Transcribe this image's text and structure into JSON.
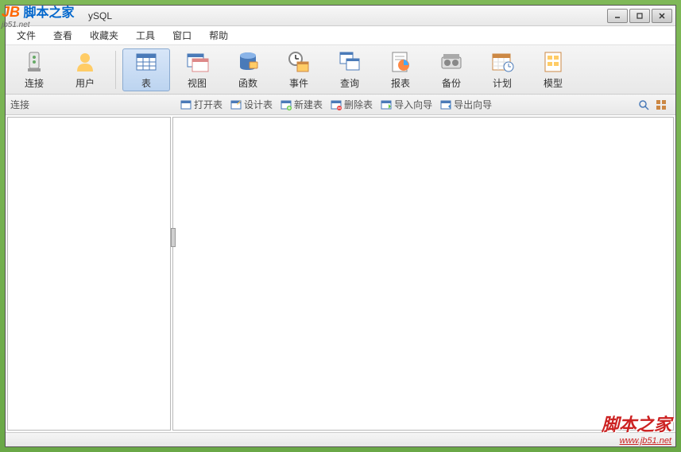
{
  "window": {
    "title": "ySQL"
  },
  "menu": {
    "file": "文件",
    "view": "查看",
    "favorites": "收藏夹",
    "tools": "工具",
    "window": "窗口",
    "help": "帮助"
  },
  "toolbar": {
    "connection": "连接",
    "user": "用户",
    "table": "表",
    "view": "视图",
    "function": "函数",
    "event": "事件",
    "query": "查询",
    "report": "报表",
    "backup": "备份",
    "schedule": "计划",
    "model": "模型"
  },
  "subbar": {
    "connection_label": "连接",
    "open_table": "打开表",
    "design_table": "设计表",
    "new_table": "新建表",
    "delete_table": "删除表",
    "import_wizard": "导入向导",
    "export_wizard": "导出向导"
  },
  "watermark": {
    "top_logo_text": "脚本之家",
    "top_logo_url": "jb51.net",
    "bottom_text": "脚本之家",
    "bottom_url": "www.jb51.net"
  }
}
